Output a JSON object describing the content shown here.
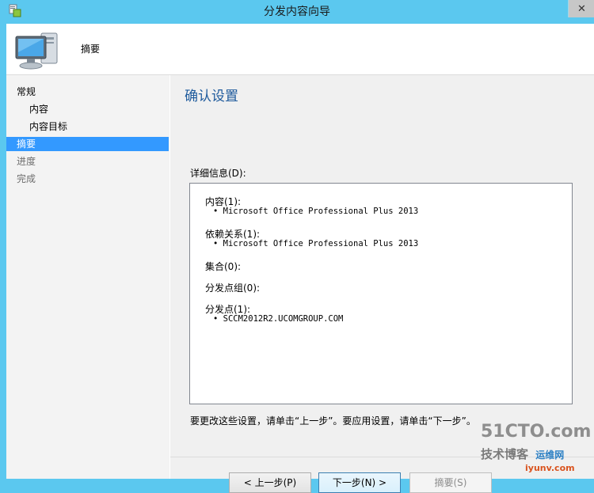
{
  "window": {
    "title": "分发内容向导",
    "close_glyph": "✕",
    "app_icon": "wizard-icon"
  },
  "header": {
    "title": "摘要",
    "icon": "computer-icon"
  },
  "nav": {
    "items": [
      {
        "label": "常规",
        "sub": false,
        "state": "normal"
      },
      {
        "label": "内容",
        "sub": true,
        "state": "normal"
      },
      {
        "label": "内容目标",
        "sub": true,
        "state": "normal"
      },
      {
        "label": "摘要",
        "sub": false,
        "state": "selected"
      },
      {
        "label": "进度",
        "sub": false,
        "state": "disabled"
      },
      {
        "label": "完成",
        "sub": false,
        "state": "disabled"
      }
    ]
  },
  "main": {
    "title": "确认设置",
    "details_label": "详细信息(D):",
    "sections": [
      {
        "title": "内容(1):",
        "bullets": [
          "• Microsoft Office Professional Plus 2013"
        ]
      },
      {
        "title": "依赖关系(1):",
        "bullets": [
          "• Microsoft Office Professional Plus 2013"
        ]
      },
      {
        "title": "集合(0):",
        "bullets": []
      },
      {
        "title": "分发点组(0):",
        "bullets": []
      },
      {
        "title": "分发点(1):",
        "bullets": [
          "• SCCM2012R2.UCOMGROUP.COM"
        ]
      }
    ],
    "hint": "要更改这些设置，请单击“上一步”。要应用设置，请单击“下一步”。"
  },
  "buttons": {
    "prev": "< 上一步(P)",
    "next": "下一步(N) >",
    "summary": "摘要(S)"
  },
  "watermark": {
    "main": "51CTO.com",
    "sub": "技术博客",
    "url": "iyunv.com",
    "sub2": "运维网"
  },
  "colors": {
    "titlebar": "#5bc8ef",
    "selected": "#3399ff",
    "page_title": "#1e5a9c"
  }
}
